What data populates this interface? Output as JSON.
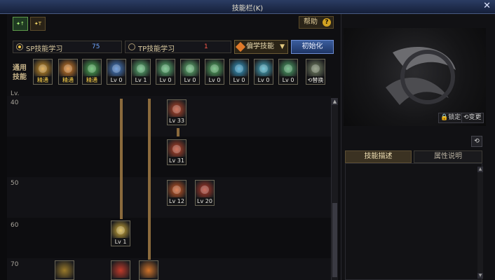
{
  "window": {
    "title": "技能栏(K)",
    "close": "✕"
  },
  "tabs": [
    {
      "label": "✦↑"
    },
    {
      "label": "✦T"
    }
  ],
  "help": {
    "label": "帮助",
    "icon": "?"
  },
  "sp": {
    "label": "SP技能学习",
    "value": "75"
  },
  "tp": {
    "label": "TP技能学习",
    "value": "1"
  },
  "dropdown": {
    "label": "偏学技能",
    "arrow": "▼"
  },
  "init_button": "初始化",
  "common": {
    "label": "通用技能",
    "skills": [
      {
        "lv": "精通",
        "color": "#d99a2a"
      },
      {
        "lv": "精通",
        "color": "#e2862a"
      },
      {
        "lv": "精通",
        "color": "#4fb85a"
      },
      {
        "lv": "Lv 0",
        "color": "#4a86d6"
      },
      {
        "lv": "Lv 1",
        "color": "#5fc07a"
      },
      {
        "lv": "Lv 0",
        "color": "#5fc07a"
      },
      {
        "lv": "Lv 0",
        "color": "#67c37b"
      },
      {
        "lv": "Lv 0",
        "color": "#59b86a"
      },
      {
        "lv": "Lv 0",
        "color": "#38a6d4"
      },
      {
        "lv": "Lv 0",
        "color": "#49b6d0"
      },
      {
        "lv": "Lv 0",
        "color": "#52b070"
      },
      {
        "lv": "⟲替换",
        "color": "#7b8b6a"
      }
    ]
  },
  "tree": {
    "header": "Lv.",
    "levels": [
      "40",
      "50",
      "60",
      "70"
    ],
    "skills": [
      {
        "lv": "Lv 33",
        "color": "#c2492c"
      },
      {
        "lv": "Lv 31",
        "color": "#c2462a"
      },
      {
        "lv": "Lv 12",
        "color": "#d35b25"
      },
      {
        "lv": "Lv 20",
        "color": "#b83a2a"
      },
      {
        "lv": "Lv 1",
        "color": "#d8b23a"
      }
    ]
  },
  "right": {
    "lock": "🔒锁定",
    "change": "⟲变更",
    "small_icon": "⟲",
    "tabs": {
      "desc": "技能描述",
      "attr": "属性说明"
    }
  }
}
